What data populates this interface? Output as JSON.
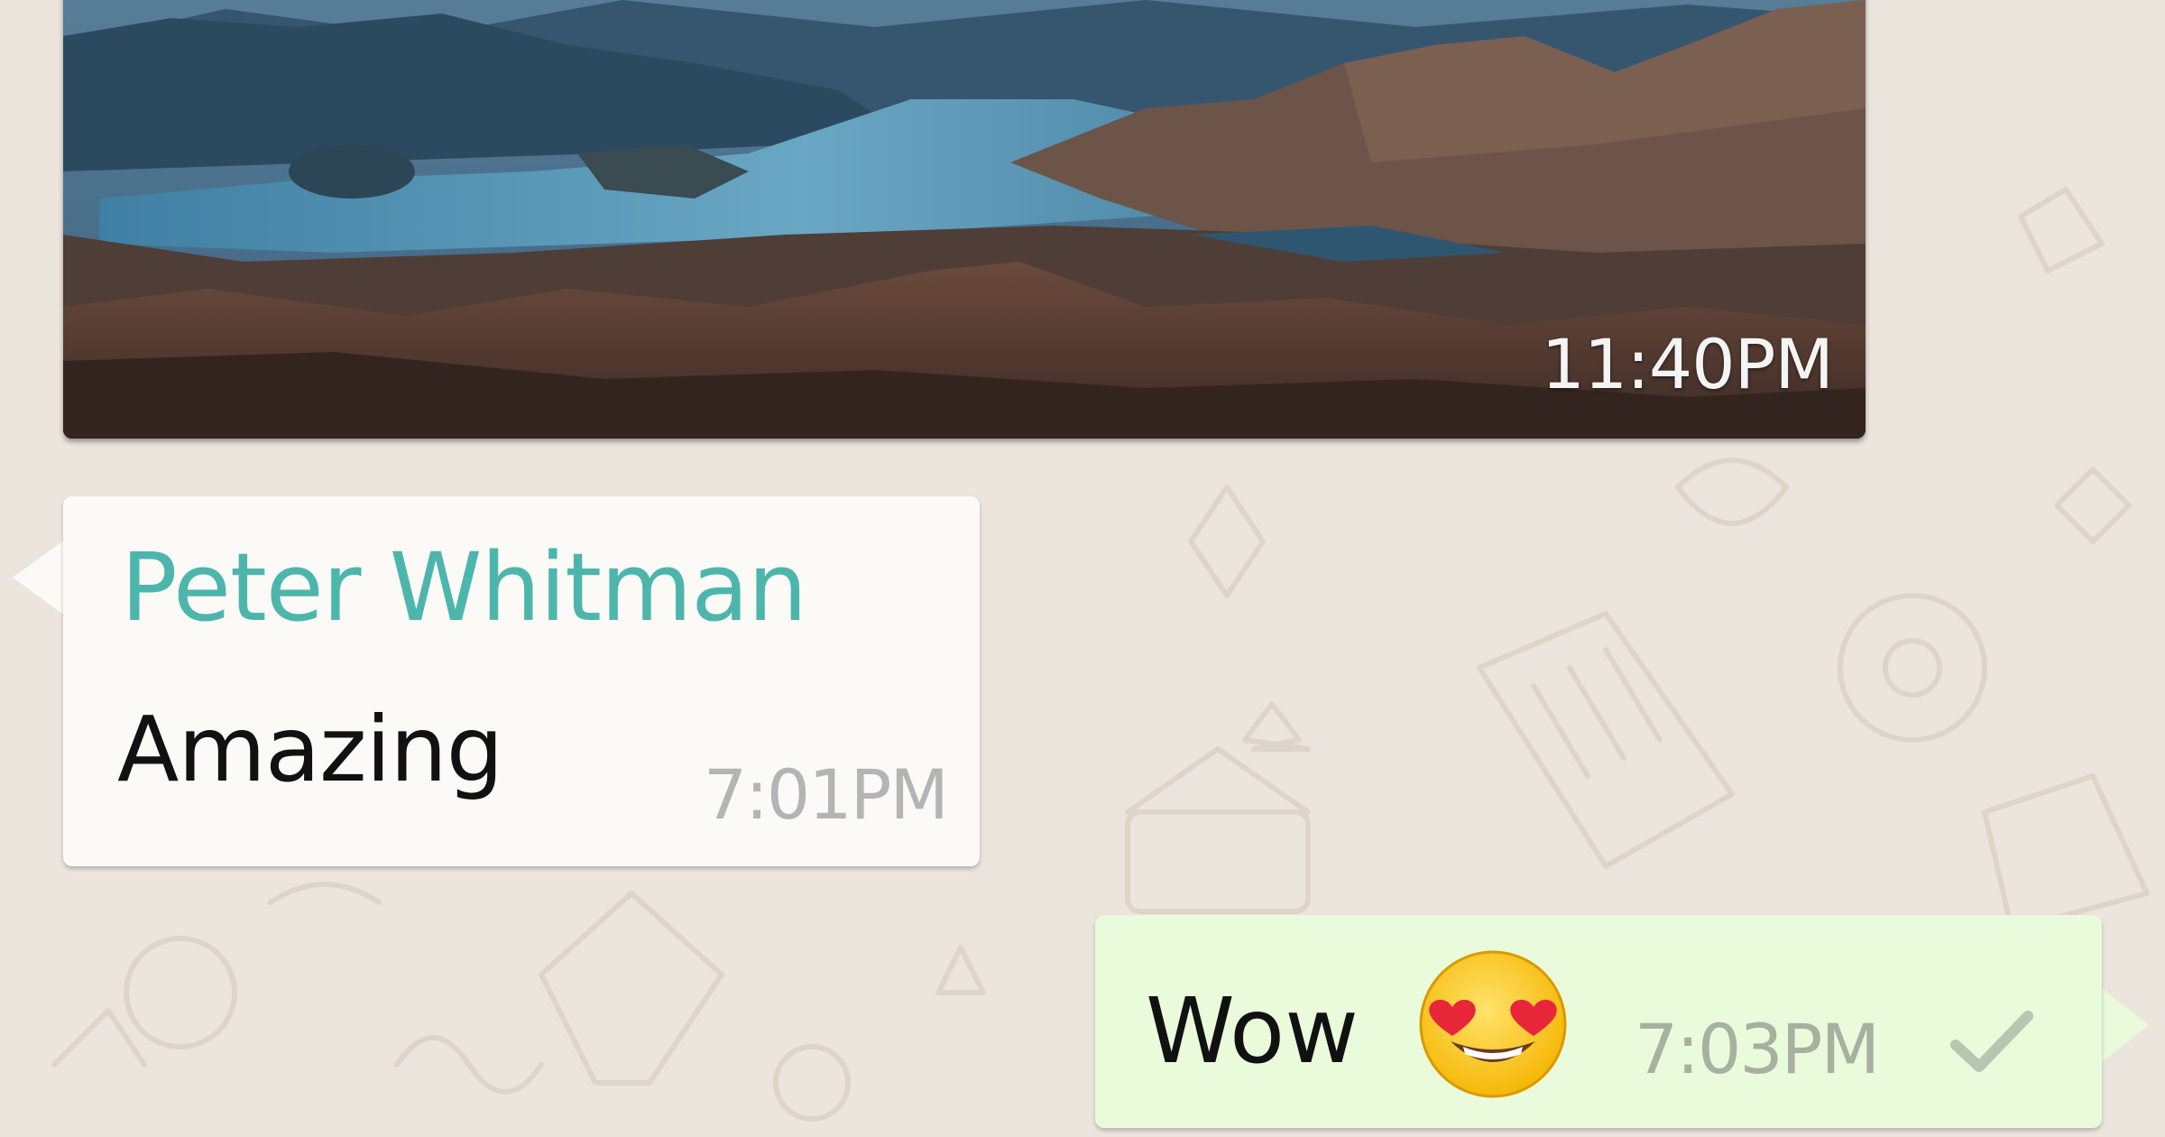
{
  "messages": {
    "image_message": {
      "time": "11:40PM"
    },
    "incoming_message": {
      "sender": "Peter Whitman",
      "text": "Amazing",
      "time": "7:01PM"
    },
    "outgoing_message": {
      "text": "Wow",
      "emoji": "heart-eyes-emoji",
      "time": "7:03PM",
      "status_icon": "single-check-icon"
    }
  },
  "colors": {
    "chat_background": "#ece5dd",
    "incoming_bubble": "#fbfaf7",
    "outgoing_bubble": "#eafbdc",
    "sender_name": "#4db6ac",
    "timestamp": "#b4b4b4"
  }
}
